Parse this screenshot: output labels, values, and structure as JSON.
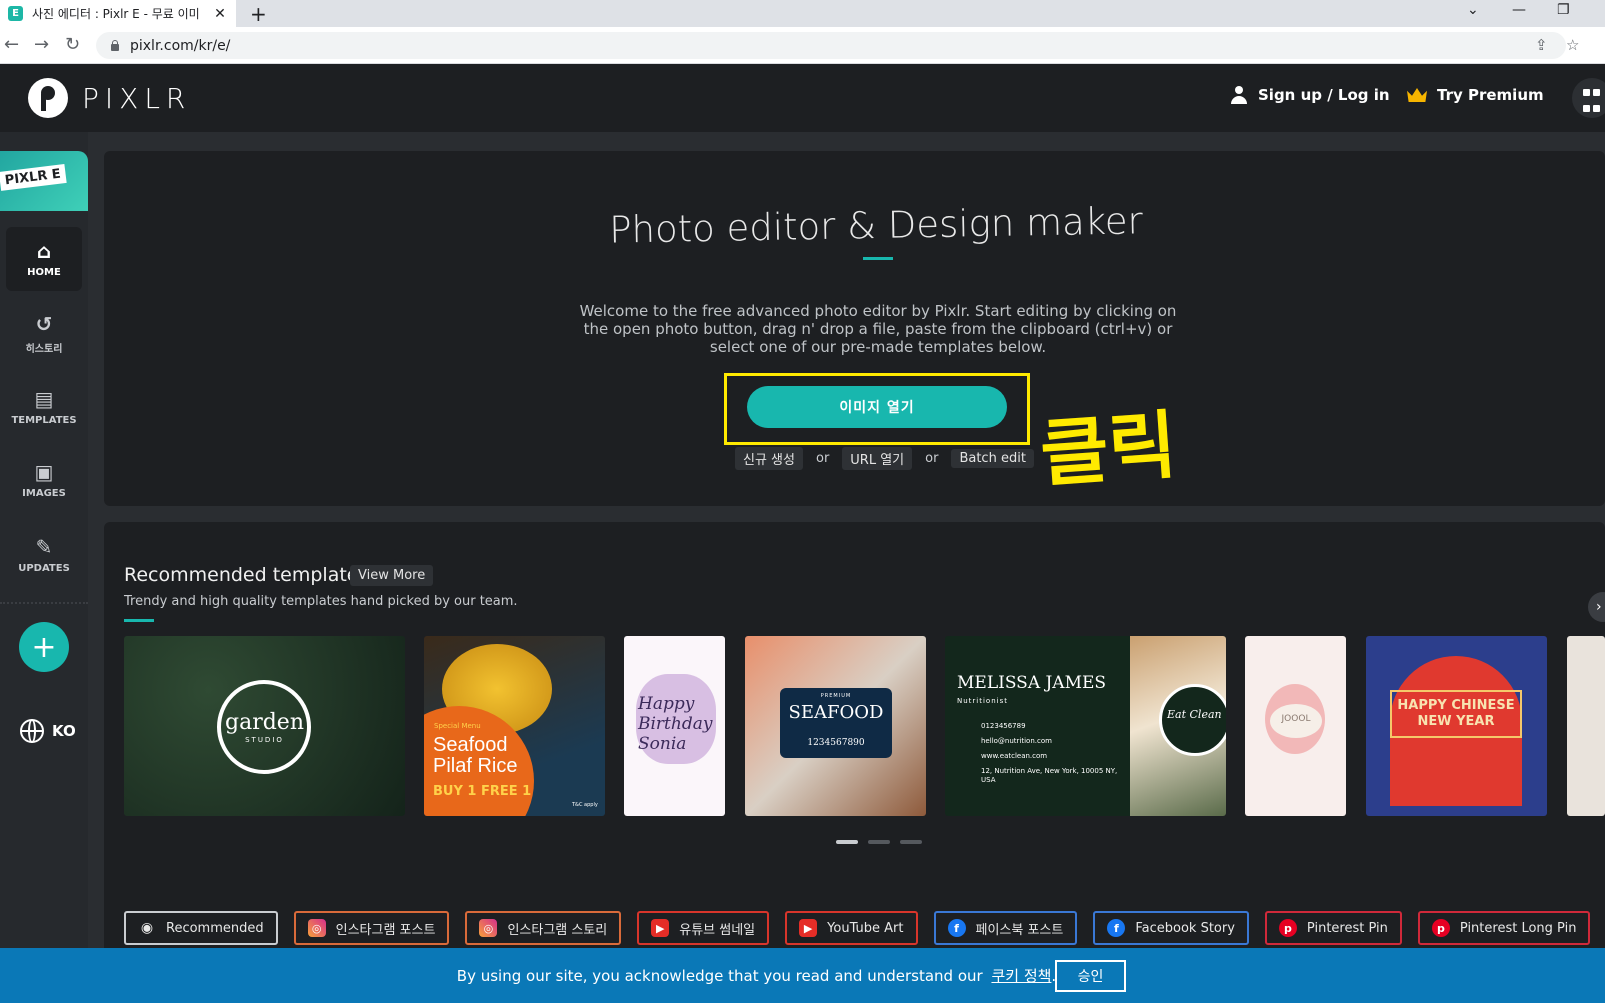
{
  "browser": {
    "tab_title": "사진 에디터 : Pixlr E - 무료 이미",
    "favicon_letter": "E",
    "url": "pixlr.com/kr/e/"
  },
  "header": {
    "logo_text": "PIXLR",
    "signup": "Sign up / Log in",
    "premium": "Try Premium"
  },
  "sidebar": {
    "badge": "PIXLR E",
    "items": [
      {
        "label": "HOME",
        "icon": "home-icon"
      },
      {
        "label": "히스토리",
        "icon": "history-icon"
      },
      {
        "label": "TEMPLATES",
        "icon": "templates-icon"
      },
      {
        "label": "IMAGES",
        "icon": "images-icon"
      },
      {
        "label": "UPDATES",
        "icon": "updates-icon"
      }
    ],
    "language": "KO"
  },
  "hero": {
    "title": "Photo editor & Design maker",
    "description": "Welcome to the free advanced photo editor by Pixlr. Start editing by clicking on the open photo button, drag n' drop a file, paste from the clipboard (ctrl+v) or select one of our pre-made templates below.",
    "open_button": "이미지 열기",
    "new_button": "신규 생성",
    "or": "or",
    "url_button": "URL 열기",
    "batch_button": "Batch edit",
    "annotation": "클릭"
  },
  "templates": {
    "title": "Recommended templates",
    "view_more": "View More",
    "subtitle": "Trendy and high quality templates hand picked by our team.",
    "cards": [
      {
        "text": "garden",
        "sub": "STUDIO"
      },
      {
        "text": "Seafood Pilaf Rice",
        "tag": "Special Menu",
        "offer": "BUY 1 FREE 1",
        "note": "T&C apply"
      },
      {
        "text": "Happy Birthday Sonia"
      },
      {
        "text": "SEAFOOD",
        "tag": "PREMIUM",
        "phone": "1234567890"
      },
      {
        "text": "MELISSA JAMES",
        "role": "Nutritionist",
        "phone": "0123456789",
        "email": "hello@nutrition.com",
        "web": "www.eatclean.com",
        "addr": "12, Nutrition Ave, New York, 10005 NY, USA",
        "badge": "Eat Clean"
      },
      {
        "text": "JOOOL"
      },
      {
        "text": "HAPPY CHINESE NEW YEAR"
      }
    ],
    "chips": [
      {
        "label": "Recommended",
        "icon": "eye-icon"
      },
      {
        "label": "인스타그램 포스트",
        "icon": "instagram-icon"
      },
      {
        "label": "인스타그램 스토리",
        "icon": "instagram-icon"
      },
      {
        "label": "유튜브 썸네일",
        "icon": "youtube-icon"
      },
      {
        "label": "YouTube Art",
        "icon": "youtube-icon"
      },
      {
        "label": "페이스북 포스트",
        "icon": "facebook-icon"
      },
      {
        "label": "Facebook Story",
        "icon": "facebook-icon"
      },
      {
        "label": "Pinterest Pin",
        "icon": "pinterest-icon"
      },
      {
        "label": "Pinterest Long Pin",
        "icon": "pinterest-icon"
      }
    ]
  },
  "cookie": {
    "text": "By using our site, you acknowledge that you read and understand our",
    "link": "쿠키 정책",
    "period": ".",
    "accept": "승인"
  },
  "colors": {
    "accent": "#18b7ae",
    "highlight": "#ffea00",
    "cookie_bar": "#0a78b7"
  }
}
